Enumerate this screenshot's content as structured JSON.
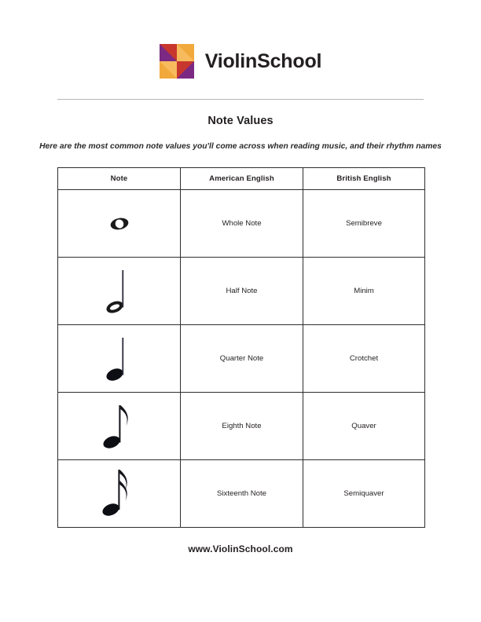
{
  "logo": {
    "wordmark": "ViolinSchool",
    "colors": {
      "purple": "#7b2982",
      "red": "#c8372d",
      "gold_light": "#f7bb5e",
      "gold_dark": "#f2a93b"
    }
  },
  "title": "Note Values",
  "subtitle": "Here are the most common note values you'll come across when reading music, and their rhythm names",
  "table": {
    "headers": [
      "Note",
      "American English",
      "British English"
    ],
    "rows": [
      {
        "glyph": "whole-note",
        "american": "Whole Note",
        "british": "Semibreve"
      },
      {
        "glyph": "half-note",
        "american": "Half Note",
        "british": "Minim"
      },
      {
        "glyph": "quarter-note",
        "american": "Quarter Note",
        "british": "Crotchet"
      },
      {
        "glyph": "eighth-note",
        "american": "Eighth Note",
        "british": "Quaver"
      },
      {
        "glyph": "sixteenth-note",
        "american": "Sixteenth Note",
        "british": "Semiquaver"
      }
    ]
  },
  "footer": "www.ViolinSchool.com"
}
